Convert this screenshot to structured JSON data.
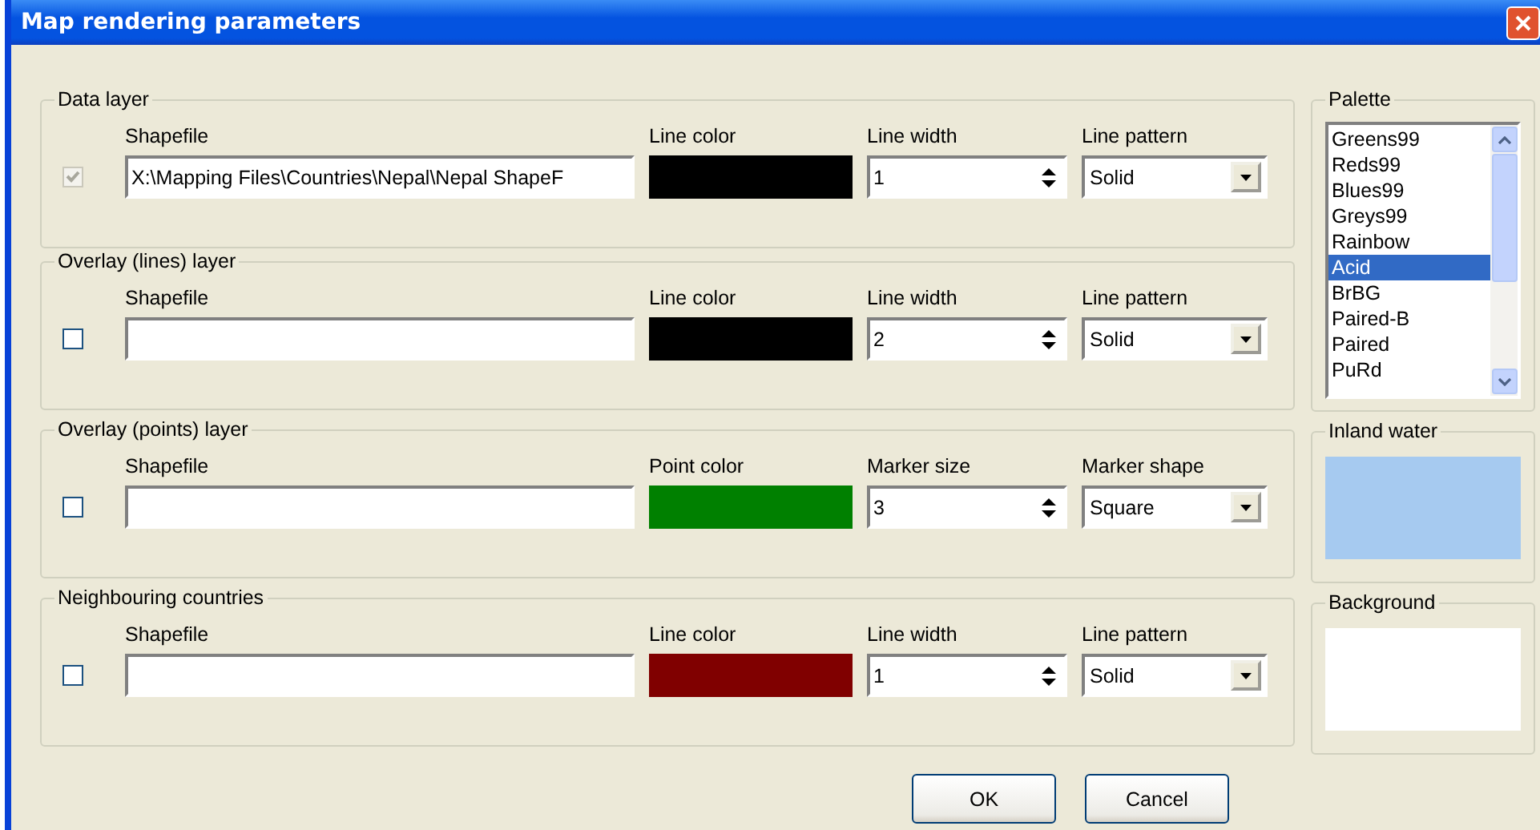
{
  "window": {
    "title": "Map rendering parameters"
  },
  "layers": [
    {
      "title": "Data layer",
      "checked": true,
      "disabled": true,
      "shapefile_label": "Shapefile",
      "shapefile": "X:\\Mapping Files\\Countries\\Nepal\\Nepal ShapeF",
      "color_label": "Line color",
      "color": "#000000",
      "size_label": "Line width",
      "size": "1",
      "style_label": "Line pattern",
      "style": "Solid"
    },
    {
      "title": "Overlay (lines) layer",
      "checked": false,
      "disabled": false,
      "shapefile_label": "Shapefile",
      "color_label": "Line color",
      "color": "#000000",
      "size_label": "Line width",
      "size": "2",
      "style_label": "Line pattern",
      "style": "Solid"
    },
    {
      "title": "Overlay (points) layer",
      "checked": false,
      "disabled": false,
      "shapefile_label": "Shapefile",
      "color_label": "Point color",
      "color": "#008000",
      "size_label": "Marker size",
      "size": "3",
      "style_label": "Marker shape",
      "style": "Square"
    },
    {
      "title": "Neighbouring countries",
      "checked": false,
      "disabled": false,
      "shapefile_label": "Shapefile",
      "color_label": "Line color",
      "color": "#800000",
      "size_label": "Line width",
      "size": "1",
      "style_label": "Line pattern",
      "style": "Solid"
    }
  ],
  "palette": {
    "title": "Palette",
    "items": [
      {
        "label": "Greens99",
        "selected": false
      },
      {
        "label": "Reds99",
        "selected": false
      },
      {
        "label": "Blues99",
        "selected": false
      },
      {
        "label": "Greys99",
        "selected": false
      },
      {
        "label": "Rainbow",
        "selected": false
      },
      {
        "label": "Acid",
        "selected": true
      },
      {
        "label": "BrBG",
        "selected": false
      },
      {
        "label": "Paired-B",
        "selected": false
      },
      {
        "label": "Paired",
        "selected": false
      },
      {
        "label": "PuRd",
        "selected": false
      }
    ]
  },
  "inland_water": {
    "title": "Inland water",
    "color": "#a6caf0"
  },
  "background": {
    "title": "Background",
    "color": "#ffffff"
  },
  "buttons": [
    "OK",
    "Cancel"
  ]
}
